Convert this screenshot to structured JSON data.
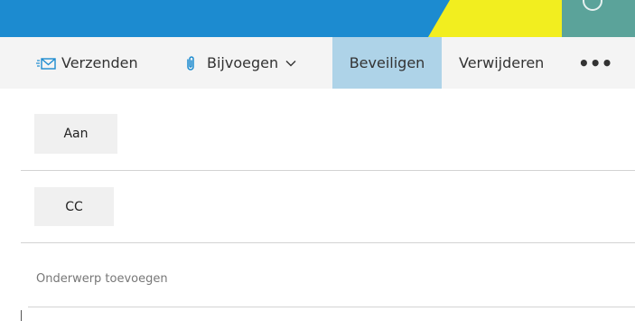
{
  "toolbar": {
    "send_label": "Verzenden",
    "attach_label": "Bijvoegen",
    "secure_label": "Beveiligen",
    "delete_label": "Verwijderen",
    "more_label": "•••"
  },
  "compose": {
    "to_label": "Aan",
    "cc_label": "CC",
    "subject_placeholder": "Onderwerp toevoegen"
  },
  "icons": {
    "send": "send-mail-icon",
    "attach": "paperclip-icon",
    "attach_dropdown": "chevron-down-icon",
    "more": "ellipsis-icon"
  },
  "colors": {
    "banner_blue": "#1c8bd0",
    "banner_yellow": "#f2ee1f",
    "banner_teal": "#5ba39a",
    "toolbar_bg": "#f4f4f4",
    "selected_tab": "#aed3e8",
    "accent_icon": "#1c8bd0"
  }
}
